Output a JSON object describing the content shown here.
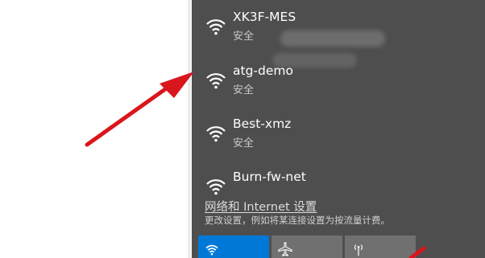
{
  "networks": [
    {
      "name": "XK3F-MES",
      "status": "安全"
    },
    {
      "name": "atg-demo",
      "status": "安全"
    },
    {
      "name": "Best-xmz",
      "status": "安全"
    },
    {
      "name": "Burn-fw-net",
      "status": ""
    }
  ],
  "settings": {
    "link_label": "网络和 Internet 设置",
    "description": "更改设置，例如将某连接设置为按流量计费。"
  },
  "quick_actions": [
    {
      "icon": "wifi-icon",
      "active": true
    },
    {
      "icon": "airplane-icon",
      "active": false
    },
    {
      "icon": "mobile-hotspot-icon",
      "active": false
    }
  ],
  "colors": {
    "panel_bg": "#4e4e4e",
    "accent": "#0078d7",
    "tile_inactive": "#707070",
    "annotation_arrow": "#d9161c"
  }
}
